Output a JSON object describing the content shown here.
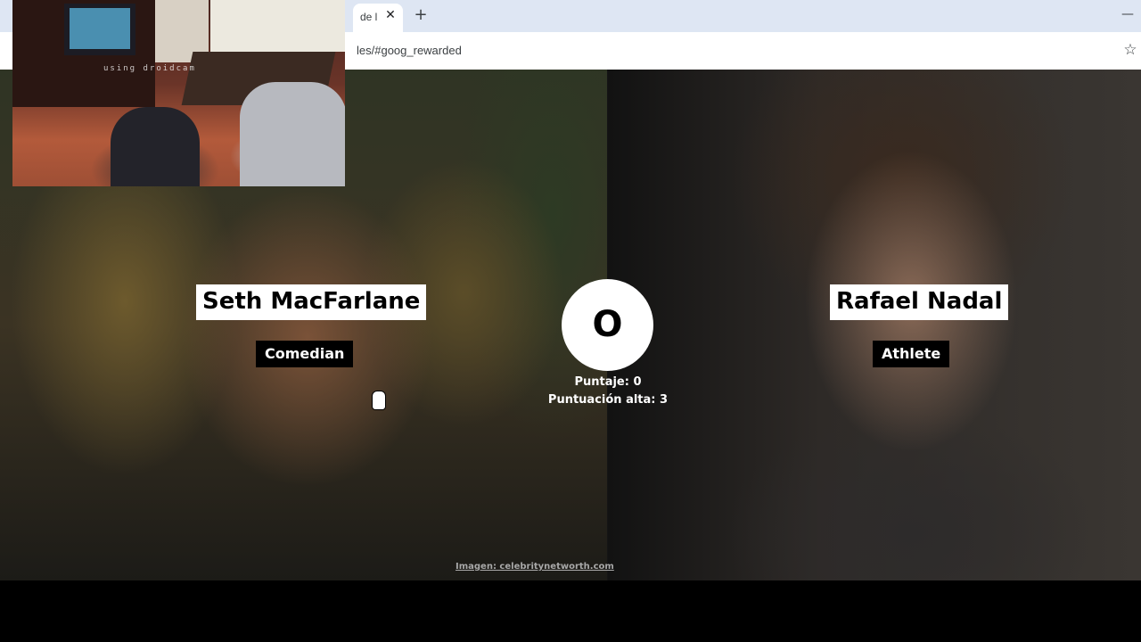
{
  "browser": {
    "tab_title": "de l",
    "tab_close_glyph": "✕",
    "new_tab_glyph": "+",
    "minimize_glyph": "—",
    "url": "les/#goog_rewarded",
    "star_glyph": "☆"
  },
  "game": {
    "left": {
      "name": "Seth MacFarlane",
      "category": "Comedian"
    },
    "right": {
      "name": "Rafael Nadal",
      "category": "Athlete"
    },
    "vs_symbol": "O",
    "score_text": "Puntaje: 0",
    "high_score_text": "Puntuación alta: 3",
    "image_credit": "Imagen: celebritynetworth.com"
  },
  "webcam": {
    "watermark": "using droidcam"
  },
  "colors": {
    "tab_strip": "#dee6f3",
    "label_bg": "#ffffff",
    "category_bg": "#000000"
  }
}
